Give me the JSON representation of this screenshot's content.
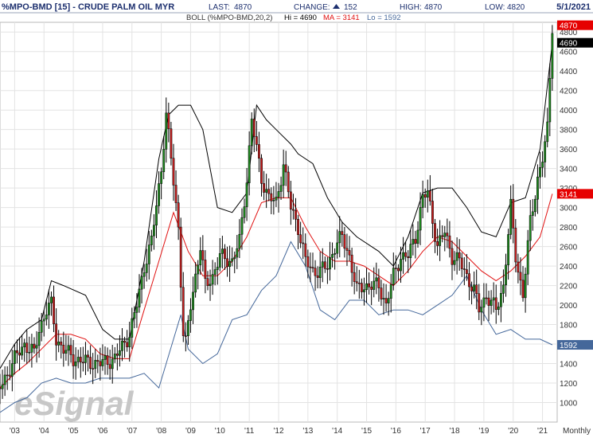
{
  "header": {
    "symbol": "%MPO-BMD [15] - CRUDE PALM OIL MYR",
    "last_label": "LAST:",
    "last_value": "4870",
    "change_label": "CHANGE:",
    "change_value": "152",
    "high_label": "HIGH:",
    "high_value": "4870",
    "low_label": "LOW:",
    "low_value": "4820",
    "date": "5/1/2021"
  },
  "study": {
    "name": "BOLL (%MPO-BMD,20,2)",
    "hi_text": "Hi = 4690",
    "ma_text": "MA = 3141",
    "lo_text": "Lo = 1592"
  },
  "watermark": "eSignal",
  "period_label": "Monthly",
  "colors": {
    "header_text": "#1c2f6e",
    "candle_up": "#1f8b1f",
    "candle_down": "#c61f1f",
    "candle_wick": "#000000",
    "upper_band": "#000000",
    "middle_band": "#e01010",
    "lower_band": "#44679a",
    "price_marker_red": "#e60000",
    "price_marker_black": "#000000",
    "price_marker_blue": "#44679a",
    "grid": "#e3e3e3",
    "change_arrow": "#1c2f6e"
  },
  "chart_data": {
    "type": "candlestick",
    "title": "%MPO-BMD [15] - CRUDE PALM OIL MYR",
    "frequency": "Monthly",
    "xlim": [
      "2002-07",
      "2021-07"
    ],
    "ylim": [
      800,
      4900
    ],
    "y_ticks": [
      1000,
      1200,
      1400,
      1600,
      1800,
      2000,
      2200,
      2400,
      2600,
      2800,
      3000,
      3200,
      3400,
      3600,
      3800,
      4000,
      4200,
      4400,
      4600,
      4800
    ],
    "x_ticks": [
      "'03",
      "'04",
      "'05",
      "'06",
      "'07",
      "'08",
      "'09",
      "'10",
      "'11",
      "'12",
      "'13",
      "'14",
      "'15",
      "'16",
      "'17",
      "'18",
      "'19",
      "'20",
      "'21"
    ],
    "grid": true,
    "price_markers": [
      {
        "label": "4870",
        "value": 4870,
        "color": "red"
      },
      {
        "label": "4690",
        "value": 4690,
        "color": "black"
      },
      {
        "label": "3141",
        "value": 3141,
        "color": "red"
      },
      {
        "label": "1592",
        "value": 1592,
        "color": "blue"
      }
    ],
    "close_path": [
      [
        "2002-07",
        1150
      ],
      [
        "2002-10",
        1300
      ],
      [
        "2003-01",
        1450
      ],
      [
        "2003-05",
        1600
      ],
      [
        "2003-09",
        1500
      ],
      [
        "2003-11",
        1750
      ],
      [
        "2004-02",
        1950
      ],
      [
        "2004-04",
        2000
      ],
      [
        "2004-06",
        1650
      ],
      [
        "2004-09",
        1550
      ],
      [
        "2005-01",
        1450
      ],
      [
        "2005-06",
        1420
      ],
      [
        "2005-12",
        1400
      ],
      [
        "2006-06",
        1450
      ],
      [
        "2006-12",
        1700
      ],
      [
        "2007-03",
        2000
      ],
      [
        "2007-06",
        2400
      ],
      [
        "2007-09",
        2650
      ],
      [
        "2008-01",
        3400
      ],
      [
        "2008-03",
        3950
      ],
      [
        "2008-05",
        3500
      ],
      [
        "2008-08",
        2800
      ],
      [
        "2008-10",
        1700
      ],
      [
        "2008-11",
        1600
      ],
      [
        "2009-01",
        2000
      ],
      [
        "2009-05",
        2600
      ],
      [
        "2009-07",
        2200
      ],
      [
        "2009-10",
        2300
      ],
      [
        "2010-01",
        2500
      ],
      [
        "2010-06",
        2450
      ],
      [
        "2010-09",
        2650
      ],
      [
        "2010-12",
        3300
      ],
      [
        "2011-02",
        3900
      ],
      [
        "2011-06",
        3300
      ],
      [
        "2011-09",
        3100
      ],
      [
        "2011-12",
        3050
      ],
      [
        "2012-03",
        3450
      ],
      [
        "2012-06",
        3000
      ],
      [
        "2012-09",
        2800
      ],
      [
        "2012-12",
        2450
      ],
      [
        "2013-03",
        2350
      ],
      [
        "2013-06",
        2350
      ],
      [
        "2013-09",
        2400
      ],
      [
        "2013-12",
        2600
      ],
      [
        "2014-03",
        2700
      ],
      [
        "2014-06",
        2500
      ],
      [
        "2014-09",
        2150
      ],
      [
        "2014-12",
        2200
      ],
      [
        "2015-03",
        2200
      ],
      [
        "2015-06",
        2200
      ],
      [
        "2015-09",
        2000
      ],
      [
        "2015-12",
        2300
      ],
      [
        "2016-03",
        2500
      ],
      [
        "2016-06",
        2500
      ],
      [
        "2016-09",
        2700
      ],
      [
        "2016-12",
        3100
      ],
      [
        "2017-02",
        3150
      ],
      [
        "2017-06",
        2600
      ],
      [
        "2017-09",
        2750
      ],
      [
        "2017-12",
        2500
      ],
      [
        "2018-03",
        2450
      ],
      [
        "2018-06",
        2300
      ],
      [
        "2018-09",
        2150
      ],
      [
        "2018-11",
        1950
      ],
      [
        "2019-02",
        2100
      ],
      [
        "2019-06",
        1950
      ],
      [
        "2019-09",
        2200
      ],
      [
        "2019-12",
        3000
      ],
      [
        "2020-02",
        2500
      ],
      [
        "2020-05",
        2100
      ],
      [
        "2020-08",
        2850
      ],
      [
        "2020-11",
        3300
      ],
      [
        "2021-01",
        3500
      ],
      [
        "2021-03",
        3800
      ],
      [
        "2021-05",
        4870
      ]
    ],
    "upper_band_path": [
      [
        "2002-07",
        1350
      ],
      [
        "2003-01",
        1600
      ],
      [
        "2003-06",
        1750
      ],
      [
        "2003-12",
        1850
      ],
      [
        "2004-04",
        2250
      ],
      [
        "2004-09",
        2200
      ],
      [
        "2005-06",
        2100
      ],
      [
        "2006-01",
        1750
      ],
      [
        "2006-06",
        1650
      ],
      [
        "2006-12",
        1650
      ],
      [
        "2007-06",
        2450
      ],
      [
        "2007-12",
        3500
      ],
      [
        "2008-04",
        3950
      ],
      [
        "2008-08",
        4050
      ],
      [
        "2009-01",
        4050
      ],
      [
        "2009-06",
        3800
      ],
      [
        "2009-12",
        3000
      ],
      [
        "2010-06",
        2950
      ],
      [
        "2010-12",
        3150
      ],
      [
        "2011-04",
        4050
      ],
      [
        "2011-08",
        3900
      ],
      [
        "2011-12",
        3800
      ],
      [
        "2012-06",
        3650
      ],
      [
        "2012-09",
        3550
      ],
      [
        "2013-03",
        3450
      ],
      [
        "2013-09",
        3100
      ],
      [
        "2014-03",
        2850
      ],
      [
        "2014-09",
        2700
      ],
      [
        "2015-06",
        2550
      ],
      [
        "2015-12",
        2400
      ],
      [
        "2016-06",
        2700
      ],
      [
        "2016-12",
        3150
      ],
      [
        "2017-06",
        3200
      ],
      [
        "2017-12",
        3200
      ],
      [
        "2018-06",
        3000
      ],
      [
        "2018-12",
        2750
      ],
      [
        "2019-06",
        2700
      ],
      [
        "2019-12",
        3050
      ],
      [
        "2020-06",
        3100
      ],
      [
        "2020-12",
        3600
      ],
      [
        "2021-05",
        4690
      ]
    ],
    "middle_band_path": [
      [
        "2002-07",
        1150
      ],
      [
        "2003-01",
        1300
      ],
      [
        "2003-06",
        1400
      ],
      [
        "2003-12",
        1550
      ],
      [
        "2004-06",
        1700
      ],
      [
        "2004-12",
        1700
      ],
      [
        "2005-06",
        1650
      ],
      [
        "2005-12",
        1500
      ],
      [
        "2006-06",
        1450
      ],
      [
        "2006-12",
        1450
      ],
      [
        "2007-06",
        1950
      ],
      [
        "2007-12",
        2450
      ],
      [
        "2008-06",
        2950
      ],
      [
        "2008-12",
        2550
      ],
      [
        "2009-06",
        2300
      ],
      [
        "2009-12",
        2300
      ],
      [
        "2010-06",
        2450
      ],
      [
        "2010-12",
        2700
      ],
      [
        "2011-06",
        3050
      ],
      [
        "2011-12",
        3100
      ],
      [
        "2012-06",
        3100
      ],
      [
        "2012-12",
        2800
      ],
      [
        "2013-06",
        2550
      ],
      [
        "2013-12",
        2450
      ],
      [
        "2014-06",
        2450
      ],
      [
        "2014-12",
        2400
      ],
      [
        "2015-06",
        2300
      ],
      [
        "2015-12",
        2200
      ],
      [
        "2016-06",
        2350
      ],
      [
        "2016-12",
        2550
      ],
      [
        "2017-06",
        2700
      ],
      [
        "2017-12",
        2650
      ],
      [
        "2018-06",
        2500
      ],
      [
        "2018-12",
        2350
      ],
      [
        "2019-06",
        2250
      ],
      [
        "2019-12",
        2350
      ],
      [
        "2020-06",
        2500
      ],
      [
        "2020-12",
        2700
      ],
      [
        "2021-05",
        3141
      ]
    ],
    "lower_band_path": [
      [
        "2002-07",
        900
      ],
      [
        "2003-01",
        1000
      ],
      [
        "2003-06",
        1050
      ],
      [
        "2003-12",
        1200
      ],
      [
        "2004-06",
        1250
      ],
      [
        "2004-12",
        1200
      ],
      [
        "2005-06",
        1200
      ],
      [
        "2005-12",
        1250
      ],
      [
        "2006-06",
        1250
      ],
      [
        "2006-12",
        1250
      ],
      [
        "2007-06",
        1300
      ],
      [
        "2007-12",
        1150
      ],
      [
        "2008-06",
        1650
      ],
      [
        "2008-09",
        1900
      ],
      [
        "2008-12",
        1550
      ],
      [
        "2009-06",
        1400
      ],
      [
        "2009-12",
        1500
      ],
      [
        "2010-06",
        1850
      ],
      [
        "2010-12",
        1900
      ],
      [
        "2011-06",
        2150
      ],
      [
        "2011-12",
        2300
      ],
      [
        "2012-06",
        2650
      ],
      [
        "2012-12",
        2400
      ],
      [
        "2013-06",
        1950
      ],
      [
        "2013-12",
        1850
      ],
      [
        "2014-06",
        2050
      ],
      [
        "2014-12",
        2050
      ],
      [
        "2015-06",
        1900
      ],
      [
        "2015-12",
        1950
      ],
      [
        "2016-06",
        1950
      ],
      [
        "2016-12",
        1900
      ],
      [
        "2017-06",
        2000
      ],
      [
        "2017-12",
        2100
      ],
      [
        "2018-06",
        2300
      ],
      [
        "2018-12",
        1950
      ],
      [
        "2019-06",
        1700
      ],
      [
        "2019-12",
        1750
      ],
      [
        "2020-06",
        1650
      ],
      [
        "2020-12",
        1650
      ],
      [
        "2021-05",
        1592
      ]
    ]
  }
}
